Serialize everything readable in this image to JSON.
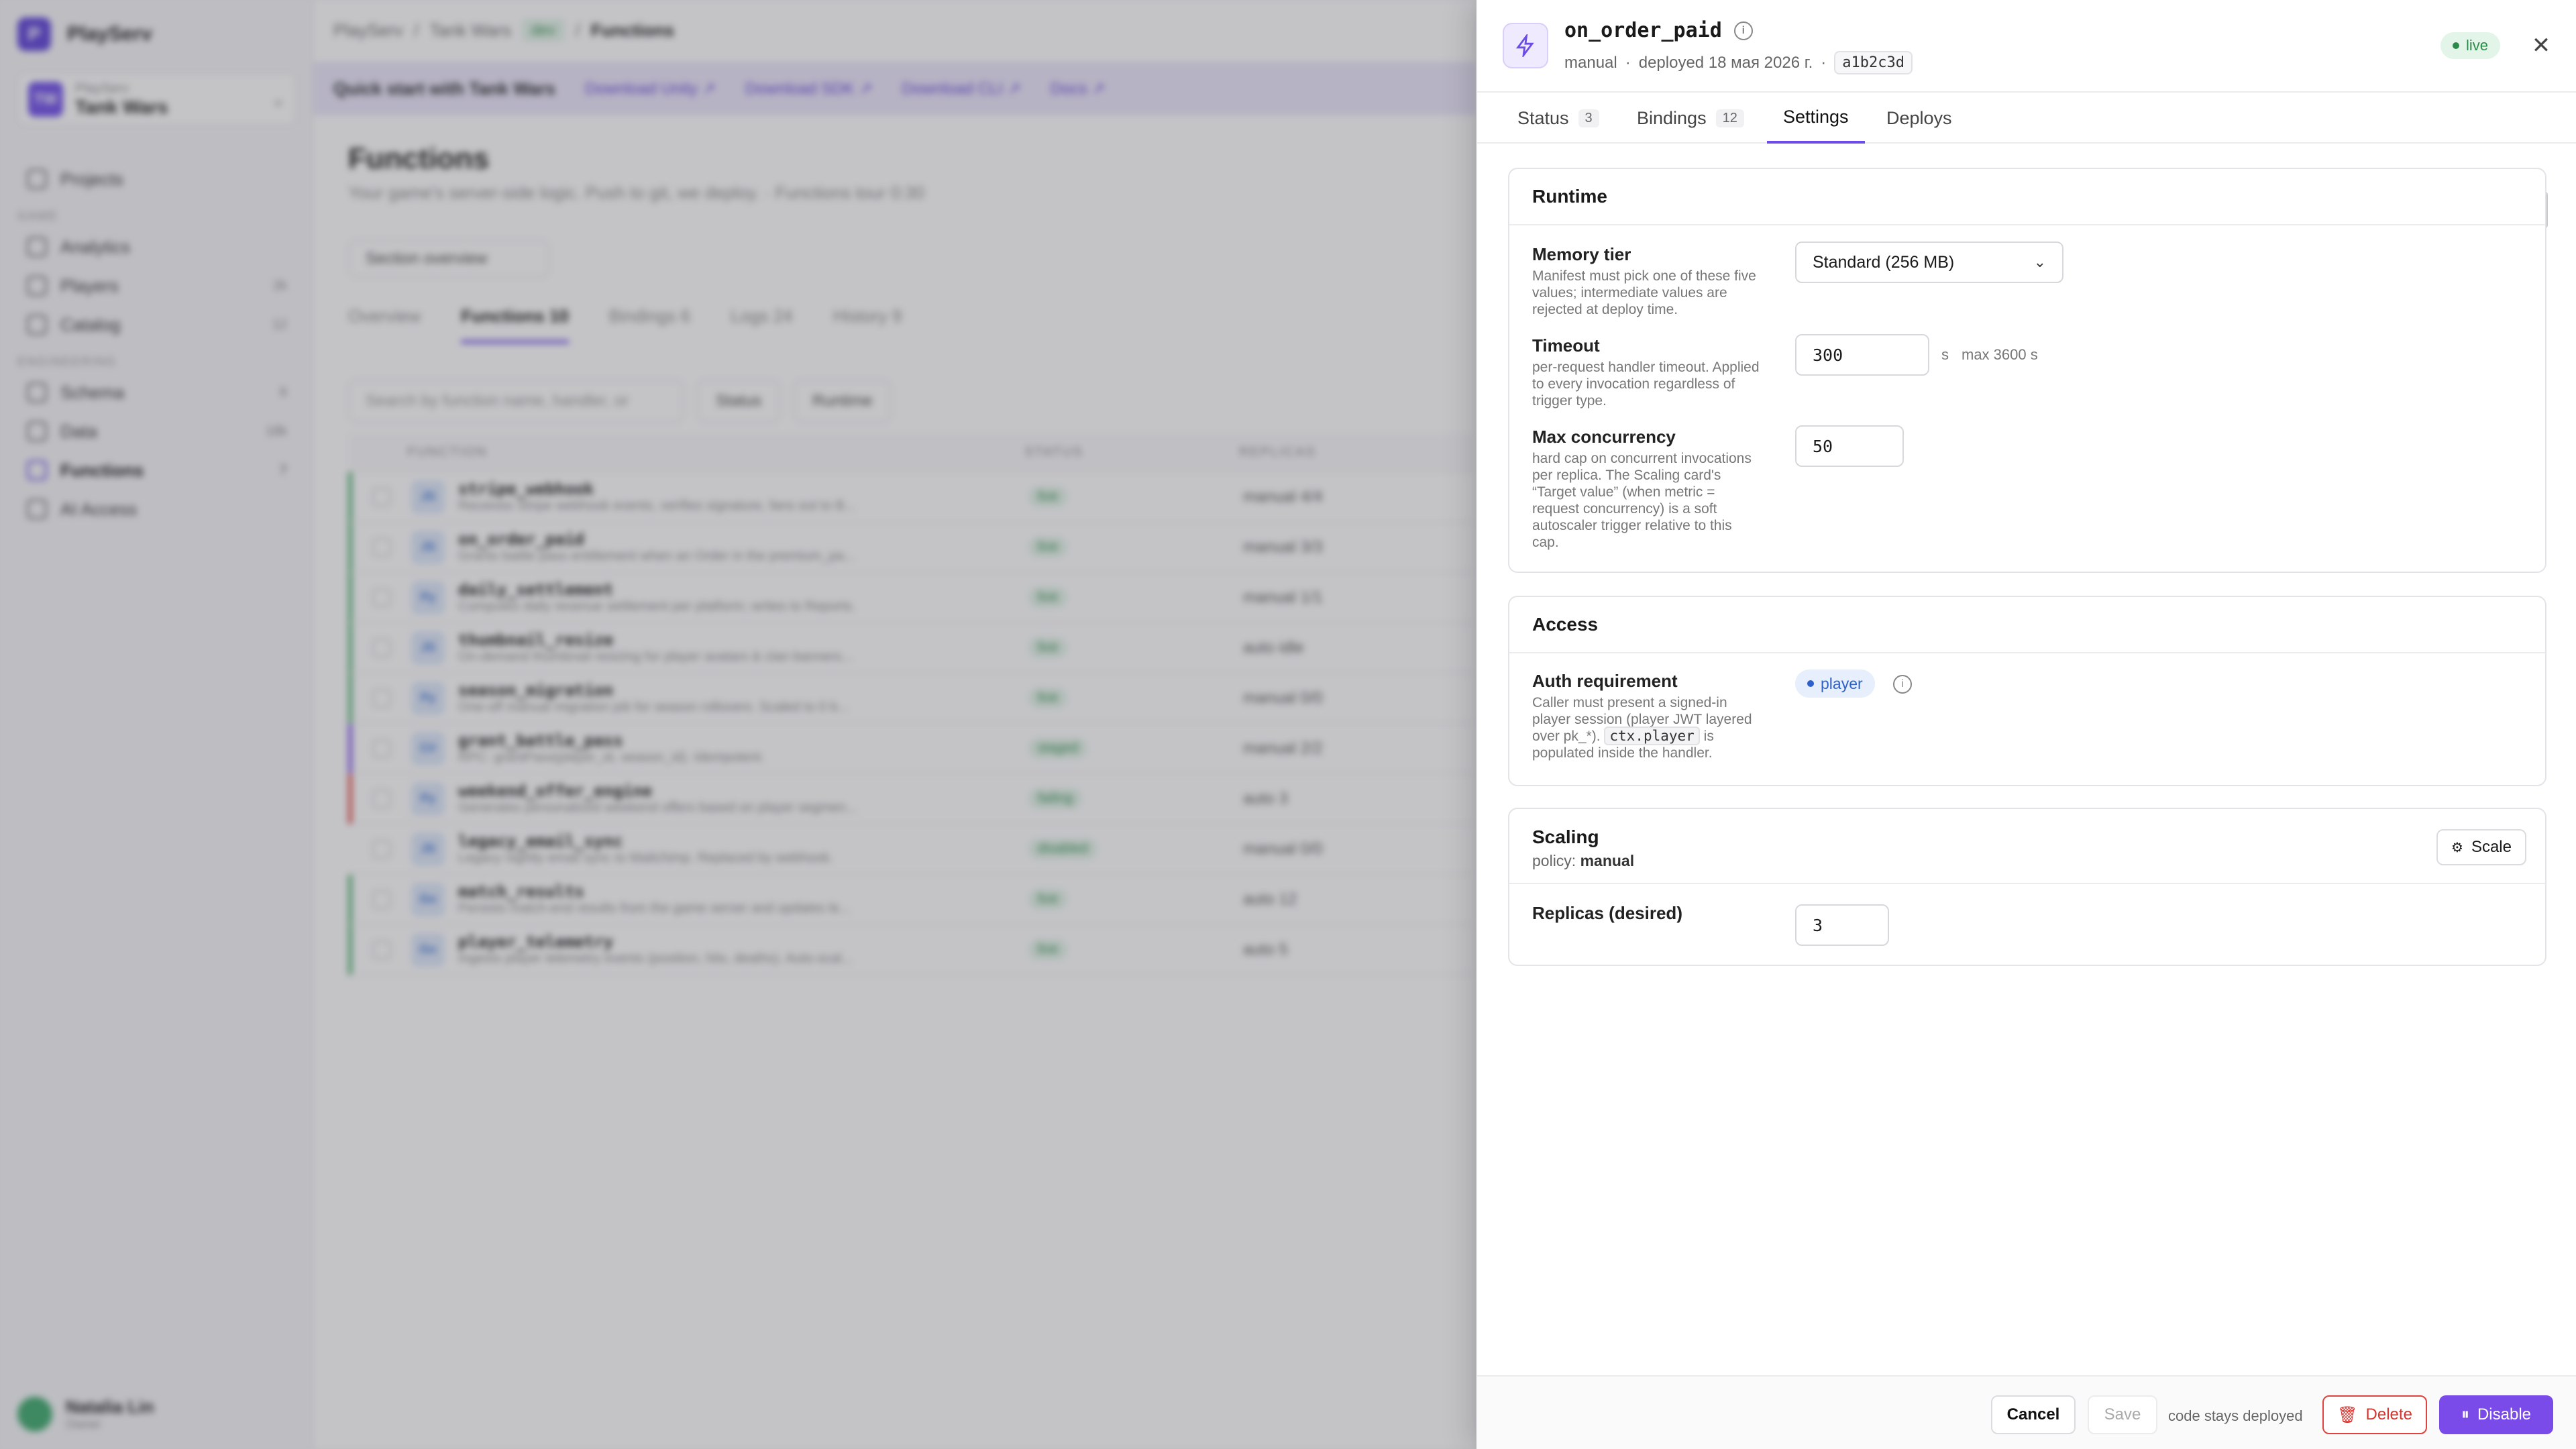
{
  "app": {
    "brand": "PlayServ",
    "brand_initial": "P",
    "project_org": "PlayServ",
    "project_name": "Tank Wars",
    "project_initials": "TW",
    "nav": {
      "projects": "Projects",
      "sec_game": "GAME",
      "analytics": "Analytics",
      "players": "Players",
      "players_count": "2k",
      "catalog": "Catalog",
      "catalog_count": "12",
      "sec_engineering": "ENGINEERING",
      "schema": "Schema",
      "schema_count": "6",
      "data": "Data",
      "data_count": "18k",
      "functions": "Functions",
      "functions_count": "7",
      "ai_access": "AI Access"
    },
    "user": {
      "name": "Natalia Lin",
      "role": "Owner"
    },
    "breadcrumb": {
      "root": "PlayServ",
      "project": "Tank Wars",
      "env": "dev",
      "page": "Functions"
    },
    "banner": {
      "title": "Quick start with Tank Wars",
      "links": [
        "Download Unity ↗",
        "Download SDK ↗",
        "Download CLI ↗",
        "Docs ↗"
      ]
    },
    "page_title": "Functions",
    "page_subtitle": "Your game's server-side logic. Push to git, we deploy.",
    "tour": "Functions tour",
    "tour_time": "0:30",
    "section_overview": "Section overview",
    "tabs": [
      {
        "label": "Overview",
        "count": ""
      },
      {
        "label": "Functions",
        "count": "10"
      },
      {
        "label": "Bindings",
        "count": "6"
      },
      {
        "label": "Logs",
        "count": "24"
      },
      {
        "label": "History",
        "count": "9"
      }
    ],
    "search_placeholder": "Search by function name, handler, or",
    "filter_status": "Status",
    "filter_runtime": "Runtime",
    "columns": {
      "function": "FUNCTION",
      "status": "STATUS",
      "replicas": "REPLICAS"
    },
    "rows": [
      {
        "rt": "JS",
        "name": "stripe_webhook",
        "desc": "Receives Stripe webhook events, verifies signature, fans out to B...",
        "status": "live",
        "replicas": "manual 4/4"
      },
      {
        "rt": "JS",
        "name": "on_order_paid",
        "desc": "Grants battle pass entitlement when an Order in the premium_pa...",
        "status": "live",
        "replicas": "manual 3/3"
      },
      {
        "rt": "Py",
        "name": "daily_settlement",
        "desc": "Computes daily revenue settlement per platform; writes to Reports.",
        "status": "live",
        "replicas": "manual 1/1"
      },
      {
        "rt": "JS",
        "name": "thumbnail_resize",
        "desc": "On-demand thumbnail resizing for player avatars & clan banners...",
        "status": "live",
        "replicas": "auto idle"
      },
      {
        "rt": "Py",
        "name": "season_migration",
        "desc": "One-off manual migration job for season rollovers. Scaled to 0 b...",
        "status": "live",
        "replicas": "manual 0/0"
      },
      {
        "rt": "C#",
        "name": "grant_battle_pass",
        "desc": "RPC: grantPass(player_id, season_id). Idempotent.",
        "status": "staged",
        "replicas": "manual 2/2"
      },
      {
        "rt": "Py",
        "name": "weekend_offer_engine",
        "desc": "Generates personalized weekend offers based on player segmen...",
        "status": "failing",
        "replicas": "auto 3"
      },
      {
        "rt": "JS",
        "name": "legacy_email_sync",
        "desc": "Legacy nightly email sync to Mailchimp. Replaced by webhook.",
        "status": "disabled",
        "replicas": "manual 0/0"
      },
      {
        "rt": "Go",
        "name": "match_results",
        "desc": "Persists match-end results from the game server and updates le...",
        "status": "live",
        "replicas": "auto 12"
      },
      {
        "rt": "Go",
        "name": "player_telemetry",
        "desc": "Ingests player telemetry events (position, hits, deaths). Auto-scal...",
        "status": "live",
        "replicas": "auto 5"
      }
    ]
  },
  "drawer": {
    "title": "on_order_paid",
    "mode": "manual",
    "deployed": "deployed 18 мая 2026 г.",
    "commit": "a1b2c3d",
    "status_pill": "live",
    "tabs": [
      {
        "label": "Status",
        "count": "3"
      },
      {
        "label": "Bindings",
        "count": "12"
      },
      {
        "label": "Settings",
        "count": ""
      },
      {
        "label": "Deploys",
        "count": ""
      }
    ],
    "runtime": {
      "title": "Runtime",
      "memory_label": "Memory tier",
      "memory_help": "Manifest must pick one of these five values; intermediate values are rejected at deploy time.",
      "memory_value": "Standard (256 MB)",
      "timeout_label": "Timeout",
      "timeout_help": "per-request handler timeout. Applied to every invocation regardless of trigger type.",
      "timeout_value": "300",
      "timeout_unit": "s",
      "timeout_max": "max 3600 s",
      "concurrency_label": "Max concurrency",
      "concurrency_help": "hard cap on concurrent invocations per replica. The Scaling card's “Target value” (when metric = request concurrency) is a soft autoscaler trigger relative to this cap.",
      "concurrency_value": "50"
    },
    "access": {
      "title": "Access",
      "auth_label": "Auth requirement",
      "auth_help_1": "Caller must present a signed-in player session (player JWT layered over pk_*).",
      "auth_help_code": "ctx.player",
      "auth_help_2": "is populated inside the handler.",
      "auth_value": "player"
    },
    "scaling": {
      "title": "Scaling",
      "policy_label": "policy:",
      "policy_value": "manual",
      "scale_button": "Scale",
      "replicas_label": "Replicas (desired)",
      "replicas_value": "3"
    },
    "footer": {
      "cancel": "Cancel",
      "save": "Save",
      "note": "code stays deployed",
      "delete": "Delete",
      "disable": "Disable"
    },
    "colors": {
      "accent": "#7a4be8",
      "danger": "#d8332d",
      "live": "#2c8a4a",
      "player": "#2f62c9"
    }
  }
}
